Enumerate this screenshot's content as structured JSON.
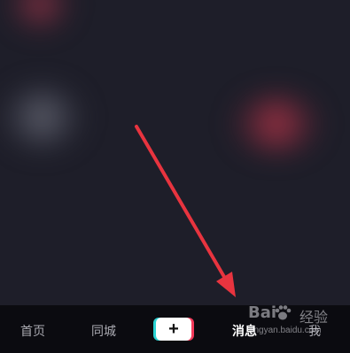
{
  "tabbar": {
    "home_label": "首页",
    "city_label": "同城",
    "add_icon": "plus-icon",
    "add_glyph": "+",
    "messages_label": "消息",
    "me_label": "我",
    "active_tab": "messages"
  },
  "watermark": {
    "brand_left": "Bai",
    "brand_right": "经验",
    "url": "jingyan.baidu.com"
  },
  "colors": {
    "arrow": "#e8343f",
    "tabbar_bg": "#0b0b10",
    "feed_bg": "#1e1e29"
  }
}
